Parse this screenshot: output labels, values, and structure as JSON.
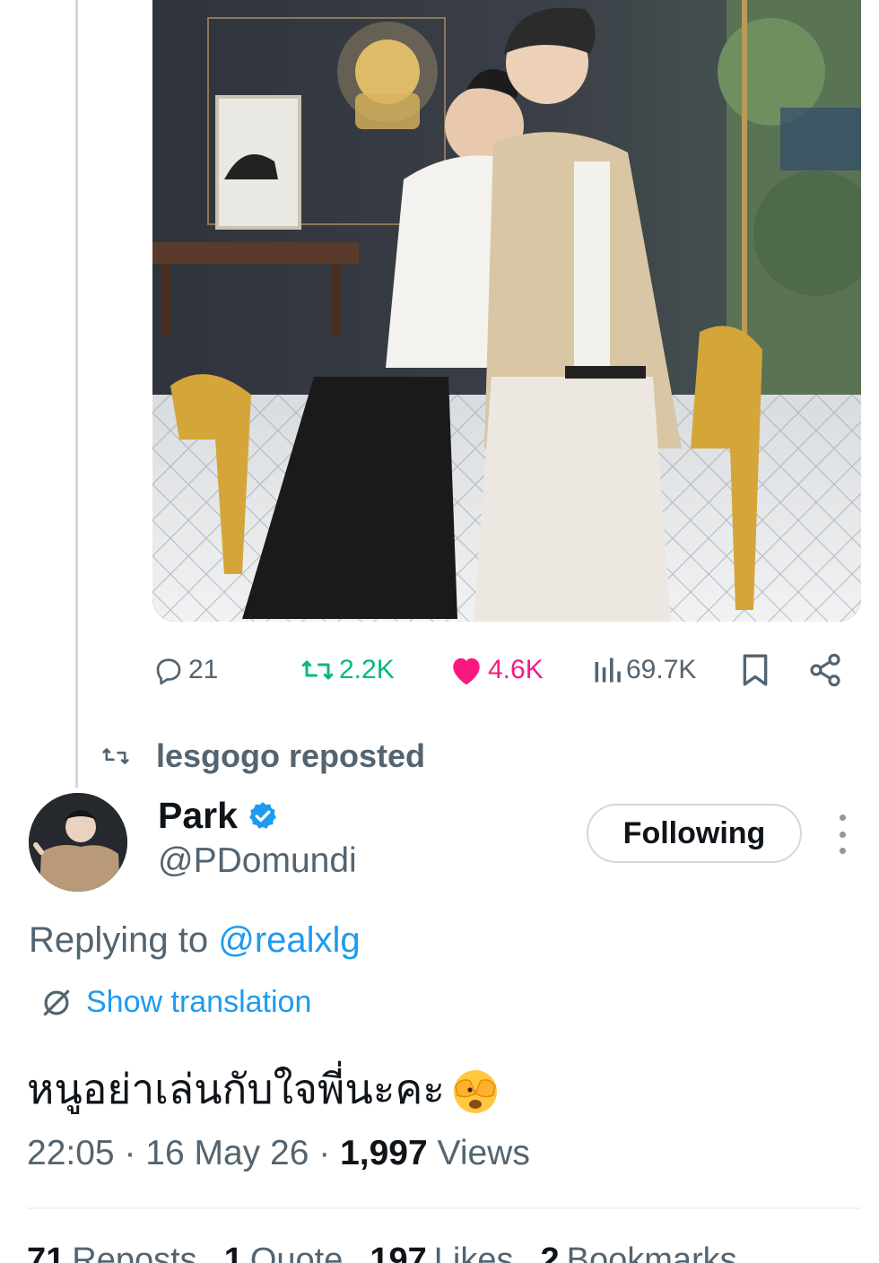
{
  "media": {
    "icon": "photo"
  },
  "actions": {
    "replies": "21",
    "reposts": "2.2K",
    "likes": "4.6K",
    "views": "69.7K"
  },
  "repost_banner": {
    "text": "lesgogo reposted"
  },
  "author": {
    "name": "Park",
    "handle": "@PDomundi",
    "verified": true,
    "follow_label": "Following"
  },
  "reply_context": {
    "prefix": "Replying to ",
    "mention": "@realxlg"
  },
  "translation": {
    "label": "Show translation"
  },
  "tweet": {
    "text": "หนูอย่าเล่นกับใจพี่นะคะ",
    "emoji": "face-with-peeking-eye"
  },
  "meta": {
    "time": "22:05",
    "date": "16 May 26",
    "views_count": "1,997",
    "views_label": "Views"
  },
  "stats": {
    "reposts_count": "71",
    "reposts_label": "Reposts",
    "quotes_count": "1",
    "quotes_label": "Quote",
    "likes_count": "197",
    "likes_label": "Likes",
    "bookmarks_count": "2",
    "bookmarks_label": "Bookmarks"
  },
  "colors": {
    "accent": "#1d9bf0",
    "repost": "#00ba7c",
    "like": "#f91880",
    "muted": "#536471"
  }
}
